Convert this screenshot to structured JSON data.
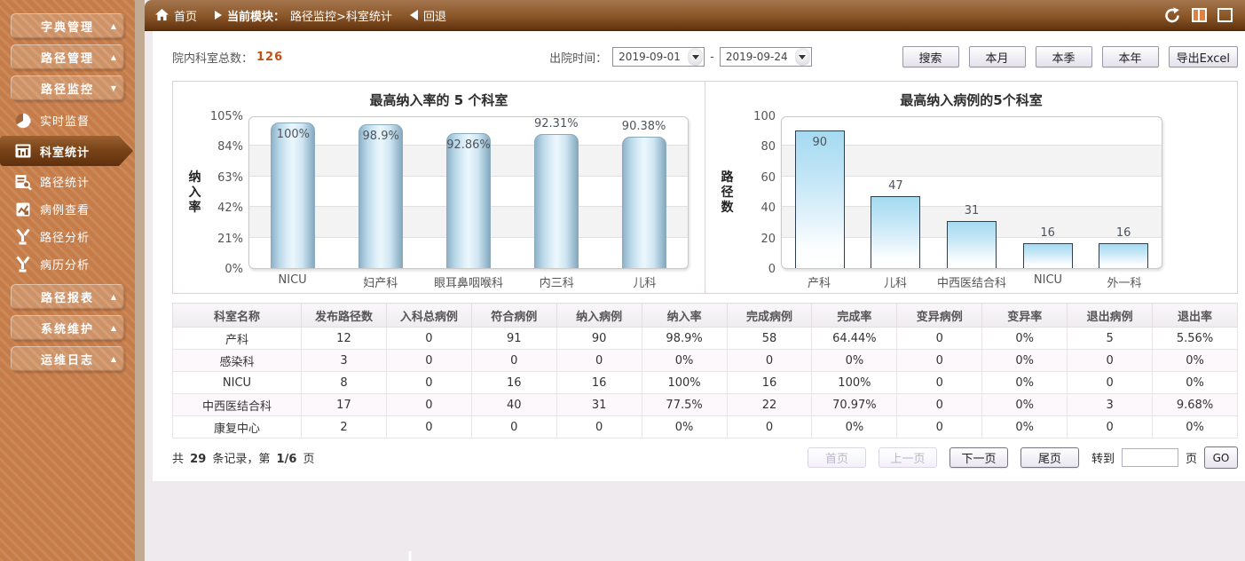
{
  "colors": {
    "sidebar_orange": "#c67c49",
    "sidebar_active_brown": "#5e300d",
    "topbar_brown": "#8a5628",
    "accent_orange_red": "#c0501a",
    "bar_blue": "#cde7f5",
    "bar_outline_dark": "#2e3e4e",
    "band_gray": "#f3f3f3",
    "table_alt_row": "#fdf8fc"
  },
  "topbar": {
    "home_label": "首页",
    "module_prefix": "当前模块：",
    "module_path": "路径监控>科室统计",
    "back_label": "回退"
  },
  "sidebar": {
    "entries": [
      {
        "type": "group",
        "label": "字典管理",
        "state": "collapsed"
      },
      {
        "type": "group",
        "label": "路径管理",
        "state": "collapsed"
      },
      {
        "type": "group",
        "label": "路径监控",
        "state": "expanded"
      },
      {
        "type": "item",
        "label": "实时监督",
        "icon": "realtime-monitor-icon",
        "active": false
      },
      {
        "type": "item",
        "label": "科室统计",
        "icon": "dept-stats-icon",
        "active": true
      },
      {
        "type": "item",
        "label": "路径统计",
        "icon": "path-stats-icon",
        "active": false
      },
      {
        "type": "item",
        "label": "病例查看",
        "icon": "case-view-icon",
        "active": false
      },
      {
        "type": "item",
        "label": "路径分析",
        "icon": "path-analysis-icon",
        "active": false
      },
      {
        "type": "item",
        "label": "病历分析",
        "icon": "record-analysis-icon",
        "active": false
      },
      {
        "type": "group",
        "label": "路径报表",
        "state": "collapsed"
      },
      {
        "type": "group",
        "label": "系统维护",
        "state": "collapsed"
      },
      {
        "type": "group",
        "label": "运维日志",
        "state": "collapsed"
      }
    ]
  },
  "filter": {
    "total_label": "院内科室总数：",
    "total_value": "126",
    "time_label": "出院时间：",
    "date_from": "2019-09-01",
    "date_to": "2019-09-24",
    "range_separator": "-",
    "buttons": [
      {
        "id": "search",
        "label": "搜索"
      },
      {
        "id": "this-month",
        "label": "本月"
      },
      {
        "id": "this-quarter",
        "label": "本季"
      },
      {
        "id": "this-year",
        "label": "本年"
      },
      {
        "id": "export-excel",
        "label": "导出Excel"
      }
    ]
  },
  "chart_data": [
    {
      "type": "bar",
      "title": "最高纳入率的 5 个科室",
      "ylabel": "纳入率",
      "xlabel": "",
      "categories": [
        "NICU",
        "妇产科",
        "眼耳鼻咽喉科",
        "内三科",
        "儿科"
      ],
      "values": [
        100,
        98.9,
        92.86,
        92.31,
        90.38
      ],
      "labels": [
        "100%",
        "98.9%",
        "92.86%",
        "92.31%",
        "90.38%"
      ],
      "label_inside": [
        true,
        true,
        true,
        false,
        false
      ],
      "ylim": [
        0,
        105
      ],
      "yticks": [
        "0%",
        "21%",
        "42%",
        "63%",
        "84%",
        "105%"
      ],
      "ytick_values": [
        0,
        21,
        42,
        63,
        84,
        105
      ],
      "grid": "alternating-bands",
      "legend": "none",
      "bar_style": "cylinder"
    },
    {
      "type": "bar",
      "title": "最高纳入病例的5个科室",
      "ylabel": "路径数",
      "xlabel": "",
      "categories": [
        "产科",
        "儿科",
        "中西医结合科",
        "NICU",
        "外一科"
      ],
      "values": [
        90,
        47,
        31,
        16,
        16
      ],
      "labels": [
        "90",
        "47",
        "31",
        "16",
        "16"
      ],
      "label_inside": [
        true,
        false,
        false,
        false,
        false
      ],
      "ylim": [
        0,
        100
      ],
      "yticks": [
        "0",
        "20",
        "40",
        "60",
        "80",
        "100"
      ],
      "ytick_values": [
        0,
        20,
        40,
        60,
        80,
        100
      ],
      "grid": "alternating-bands",
      "legend": "none",
      "bar_style": "flat"
    }
  ],
  "table": {
    "headers": [
      "科室名称",
      "发布路径数",
      "入科总病例",
      "符合病例",
      "纳入病例",
      "纳入率",
      "完成病例",
      "完成率",
      "变异病例",
      "变异率",
      "退出病例",
      "退出率"
    ],
    "rows": [
      [
        "产科",
        "12",
        "0",
        "91",
        "90",
        "98.9%",
        "58",
        "64.44%",
        "0",
        "0%",
        "5",
        "5.56%"
      ],
      [
        "感染科",
        "3",
        "0",
        "0",
        "0",
        "0%",
        "0",
        "0%",
        "0",
        "0%",
        "0",
        "0%"
      ],
      [
        "NICU",
        "8",
        "0",
        "16",
        "16",
        "100%",
        "16",
        "100%",
        "0",
        "0%",
        "0",
        "0%"
      ],
      [
        "中西医结合科",
        "17",
        "0",
        "40",
        "31",
        "77.5%",
        "22",
        "70.97%",
        "0",
        "0%",
        "3",
        "9.68%"
      ],
      [
        "康复中心",
        "2",
        "0",
        "0",
        "0",
        "0%",
        "0",
        "0%",
        "0",
        "0%",
        "0",
        "0%"
      ]
    ]
  },
  "pagination": {
    "summary_prefix": "共",
    "record_count": "29",
    "summary_middle": "条记录，第",
    "page_indicator": "1/6",
    "summary_suffix": "页",
    "buttons": [
      {
        "id": "first-page",
        "label": "首页",
        "enabled": false
      },
      {
        "id": "prev-page",
        "label": "上一页",
        "enabled": false
      },
      {
        "id": "next-page",
        "label": "下一页",
        "enabled": true
      },
      {
        "id": "last-page",
        "label": "尾页",
        "enabled": true
      }
    ],
    "goto_label": "转到",
    "goto_value": "",
    "goto_suffix": "页",
    "go_label": "GO"
  }
}
